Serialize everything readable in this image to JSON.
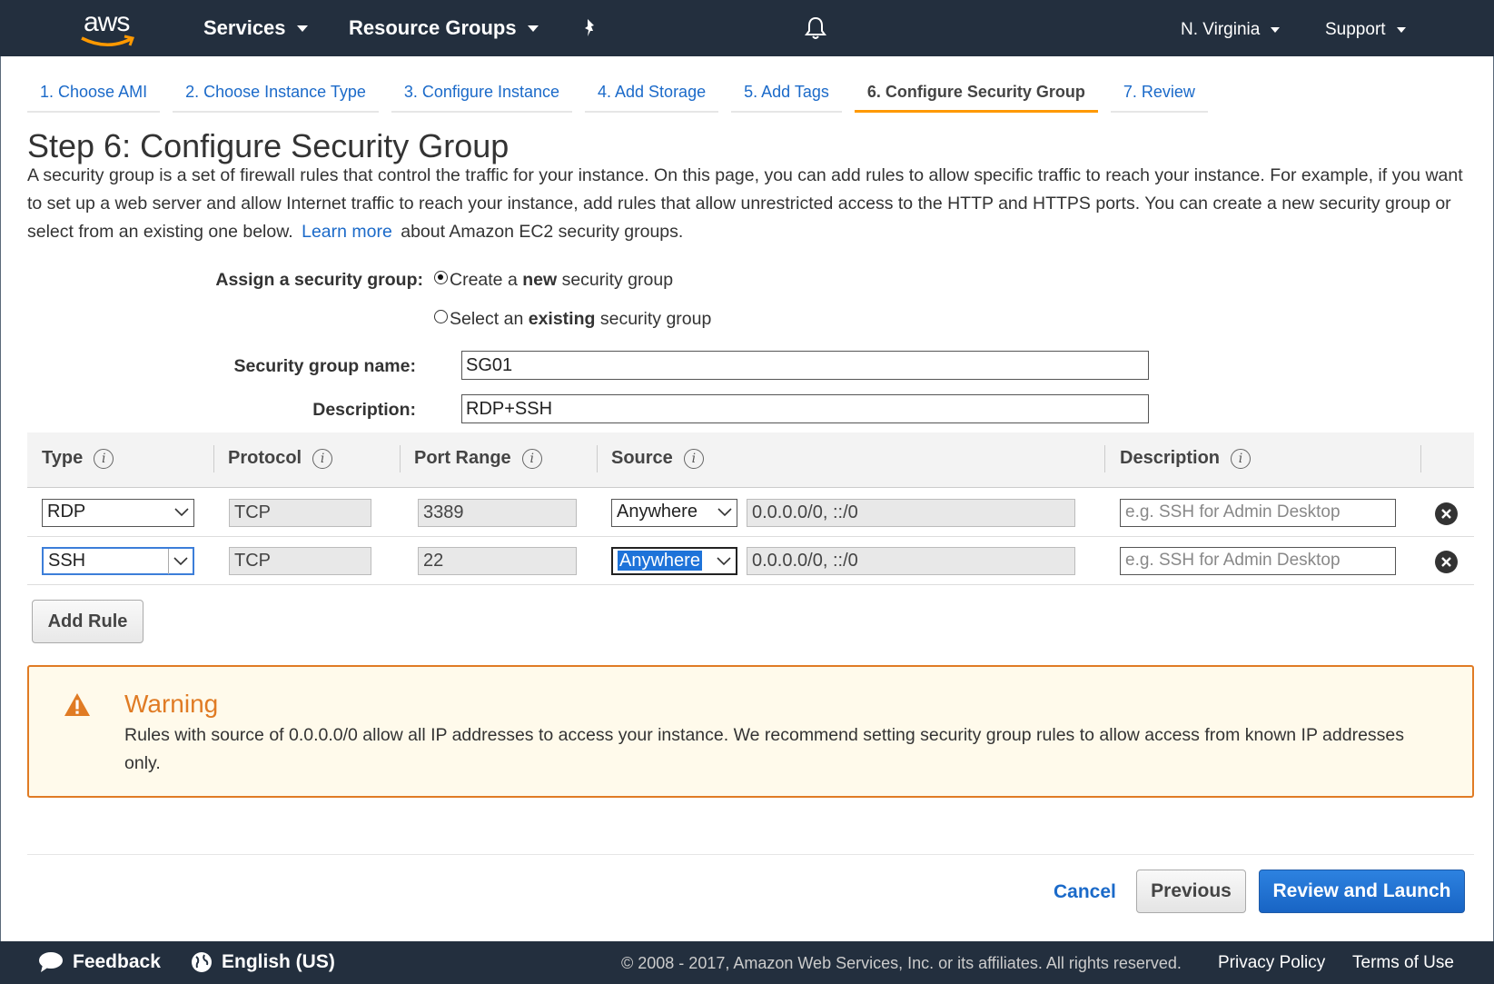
{
  "nav": {
    "logo_text": "aws",
    "services": "Services",
    "resource_groups": "Resource Groups",
    "region": "N. Virginia",
    "support": "Support"
  },
  "tabs": [
    {
      "label": "1. Choose AMI",
      "active": false
    },
    {
      "label": "2. Choose Instance Type",
      "active": false
    },
    {
      "label": "3. Configure Instance",
      "active": false
    },
    {
      "label": "4. Add Storage",
      "active": false
    },
    {
      "label": "5. Add Tags",
      "active": false
    },
    {
      "label": "6. Configure Security Group",
      "active": true
    },
    {
      "label": "7. Review",
      "active": false
    }
  ],
  "page": {
    "title": "Step 6: Configure Security Group",
    "intro": "A security group is a set of firewall rules that control the traffic for your instance. On this page, you can add rules to allow specific traffic to reach your instance. For example, if you want to set up a web server and allow Internet traffic to reach your instance, add rules that allow unrestricted access to the HTTP and HTTPS ports. You can create a new security group or select from an existing one below.",
    "learn_more": "Learn more",
    "intro_tail": "about Amazon EC2 security groups."
  },
  "assign": {
    "label": "Assign a security group:",
    "option_new_pre": "Create a ",
    "option_new_bold": "new",
    "option_new_post": " security group",
    "option_existing_pre": "Select an ",
    "option_existing_bold": "existing",
    "option_existing_post": " security group",
    "selected": "new"
  },
  "sg_form": {
    "name_label": "Security group name:",
    "name_value": "SG01",
    "desc_label": "Description:",
    "desc_value": "RDP+SSH"
  },
  "rules": {
    "headers": {
      "type": "Type",
      "protocol": "Protocol",
      "port_range": "Port Range",
      "source": "Source",
      "description": "Description"
    },
    "rows": [
      {
        "type": "RDP",
        "protocol": "TCP",
        "port": "3389",
        "source": "Anywhere",
        "cidr": "0.0.0.0/0, ::/0",
        "desc_placeholder": "e.g. SSH for Admin Desktop"
      },
      {
        "type": "SSH",
        "protocol": "TCP",
        "port": "22",
        "source": "Anywhere",
        "cidr": "0.0.0.0/0, ::/0",
        "desc_placeholder": "e.g. SSH for Admin Desktop"
      }
    ],
    "add_rule": "Add Rule"
  },
  "warning": {
    "title": "Warning",
    "text": "Rules with source of 0.0.0.0/0 allow all IP addresses to access your instance. We recommend setting security group rules to allow access from known IP addresses only.",
    "color": "#e07b24"
  },
  "actions": {
    "cancel": "Cancel",
    "previous": "Previous",
    "review_launch": "Review and Launch"
  },
  "footer": {
    "feedback": "Feedback",
    "language": "English (US)",
    "copyright": "© 2008 - 2017, Amazon Web Services, Inc. or its affiliates. All rights reserved.",
    "privacy": "Privacy Policy",
    "terms": "Terms of Use"
  },
  "colors": {
    "nav_bg": "#232f3e",
    "accent": "#ff9900",
    "link": "#1b6ac9"
  }
}
